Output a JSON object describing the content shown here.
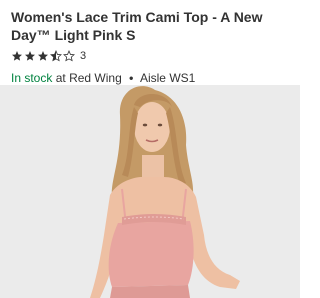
{
  "product": {
    "title": "Women's Lace Trim Cami Top - A New Day™ Light Pink S",
    "rating_count": "3",
    "rating_value": 3.5,
    "rating_max": 5
  },
  "availability": {
    "status": "In stock",
    "connector": "at",
    "store": "Red Wing",
    "separator": "•",
    "aisle": "Aisle WS1"
  },
  "colors": {
    "in_stock_green": "#00823f",
    "image_background": "#ebebeb",
    "garment_pink": "#e8a5a0"
  },
  "icons": {
    "star_full": "star-full-icon",
    "star_half": "star-half-icon",
    "star_empty": "star-empty-icon"
  }
}
